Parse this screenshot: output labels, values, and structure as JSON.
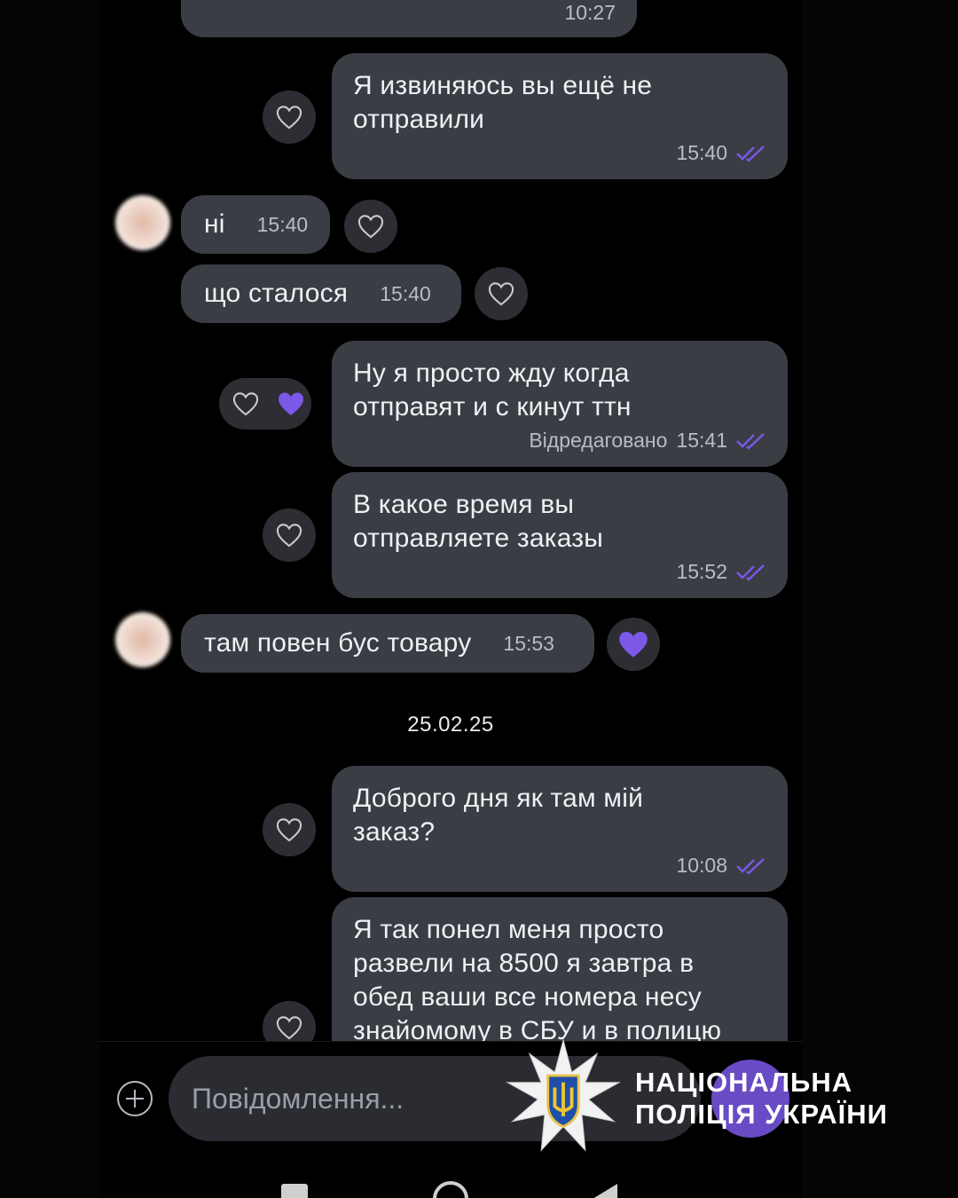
{
  "messages": [
    {
      "id": "top",
      "direction": "in",
      "time": "10:27"
    },
    {
      "id": "m1",
      "direction": "out",
      "text": "Я извиняюсь вы ещё не\nотправили",
      "time": "15:40",
      "read": true
    },
    {
      "id": "m2",
      "direction": "in",
      "text": "ні",
      "time": "15:40"
    },
    {
      "id": "m3",
      "direction": "in",
      "text": "що сталося",
      "time": "15:40"
    },
    {
      "id": "m4",
      "direction": "out",
      "text": "Ну я просто жду когда\nотправят и с кинут ттн",
      "edited": "Відредаговано",
      "time": "15:41",
      "read": true
    },
    {
      "id": "m5",
      "direction": "out",
      "text": "В какое время вы\nотправляете заказы",
      "time": "15:52",
      "read": true
    },
    {
      "id": "m6",
      "direction": "in",
      "text": "там повен бус товару",
      "time": "15:53"
    },
    {
      "id": "m7",
      "direction": "out",
      "text": "Доброго дня як там мій\nзаказ?",
      "time": "10:08",
      "read": true
    },
    {
      "id": "m8",
      "direction": "out",
      "text": "Я так понел меня просто\nразвели на 8500 я завтра в\nобед ваши все номера несу\nзнайомому в СБУ и в полицю"
    }
  ],
  "date_separator": "25.02.25",
  "composer": {
    "placeholder": "Повідомлення..."
  },
  "watermark": {
    "line1": "НАЦІОНАЛЬНА",
    "line2": "ПОЛІЦІЯ УКРАЇНИ"
  },
  "colors": {
    "accent": "#7b58e8",
    "bubble": "#3a3d44",
    "background": "#000000",
    "heart_liked": "#7b58e8"
  },
  "icons": {
    "heart": "heart-icon",
    "read": "double-check-icon",
    "add": "plus-circle-icon"
  }
}
